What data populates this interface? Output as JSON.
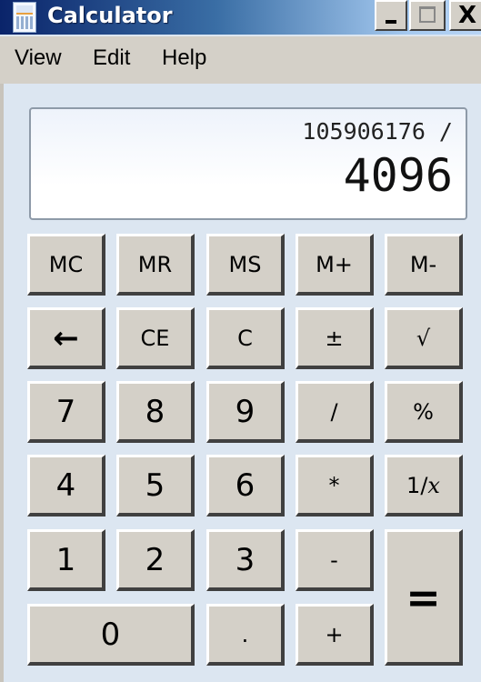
{
  "window": {
    "title": "Calculator",
    "icon": "calculator-icon",
    "controls": {
      "minimize": "minimize-icon",
      "maximize": "maximize-icon",
      "close": "close-icon",
      "close_glyph": "X"
    }
  },
  "menu": [
    {
      "label": "View"
    },
    {
      "label": "Edit"
    },
    {
      "label": "Help"
    }
  ],
  "display": {
    "expression": "105906176 /",
    "value": "4096"
  },
  "keys": {
    "mc": "MC",
    "mr": "MR",
    "ms": "MS",
    "mplus": "M+",
    "mminus": "M-",
    "backspace": "←",
    "ce": "CE",
    "c": "C",
    "plusminus": "±",
    "sqrt": "√",
    "n7": "7",
    "n8": "8",
    "n9": "9",
    "divide": "/",
    "percent": "%",
    "n4": "4",
    "n5": "5",
    "n6": "6",
    "multiply": "*",
    "reciprocal_prefix": "1/",
    "reciprocal_var": "x",
    "n1": "1",
    "n2": "2",
    "n3": "3",
    "subtract": "-",
    "equals": "=",
    "n0": "0",
    "decimal": ".",
    "add": "+"
  }
}
